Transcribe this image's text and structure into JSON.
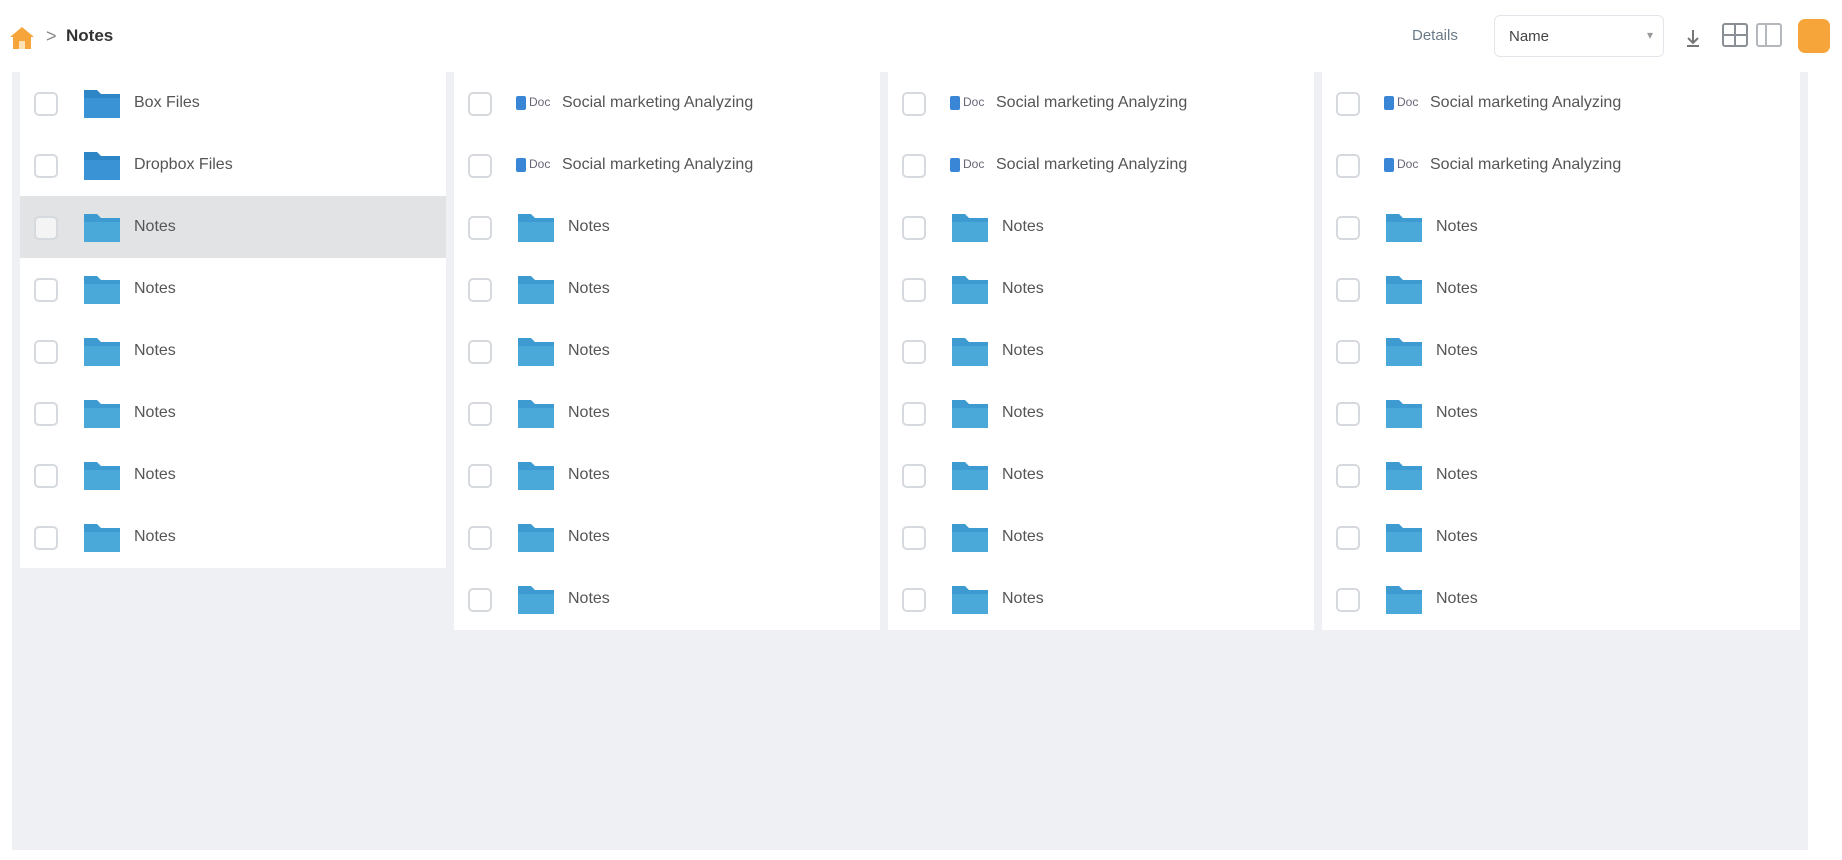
{
  "breadcrumb": {
    "separator": ">",
    "current": "Notes"
  },
  "toolbar": {
    "details_label": "Details",
    "sort_label": "Name",
    "sort_icon": "sort-arrow-icon",
    "view_icons": [
      "grid-view-icon",
      "columns-view-icon"
    ],
    "user_icon": "user-icon"
  },
  "colors": {
    "accent": "#f5a53a",
    "folder": "#4aa9d8",
    "folder_dark": "#2f86c7",
    "selected_row": "#e2e3e5"
  },
  "columns": [
    {
      "rows": [
        {
          "type": "folder",
          "name": "Box Files",
          "variant": "dark"
        },
        {
          "type": "folder",
          "name": "Dropbox Files",
          "variant": "dark"
        },
        {
          "type": "folder",
          "name": "Notes",
          "selected": true
        },
        {
          "type": "folder",
          "name": "Notes"
        },
        {
          "type": "folder",
          "name": "Notes"
        },
        {
          "type": "folder",
          "name": "Notes"
        },
        {
          "type": "folder",
          "name": "Notes"
        },
        {
          "type": "folder",
          "name": "Notes"
        }
      ]
    },
    {
      "rows": [
        {
          "type": "file",
          "thumb": "Doc",
          "name": "Social marketing Analyzing"
        },
        {
          "type": "file",
          "thumb": "Doc",
          "name": "Social marketing Analyzing"
        },
        {
          "type": "folder",
          "name": "Notes"
        },
        {
          "type": "folder",
          "name": "Notes"
        },
        {
          "type": "folder",
          "name": "Notes"
        },
        {
          "type": "folder",
          "name": "Notes"
        },
        {
          "type": "folder",
          "name": "Notes"
        },
        {
          "type": "folder",
          "name": "Notes"
        },
        {
          "type": "folder",
          "name": "Notes"
        }
      ]
    },
    {
      "rows": [
        {
          "type": "file",
          "thumb": "Doc",
          "name": "Social marketing Analyzing"
        },
        {
          "type": "file",
          "thumb": "Doc",
          "name": "Social marketing Analyzing"
        },
        {
          "type": "folder",
          "name": "Notes"
        },
        {
          "type": "folder",
          "name": "Notes"
        },
        {
          "type": "folder",
          "name": "Notes"
        },
        {
          "type": "folder",
          "name": "Notes"
        },
        {
          "type": "folder",
          "name": "Notes"
        },
        {
          "type": "folder",
          "name": "Notes"
        },
        {
          "type": "folder",
          "name": "Notes"
        }
      ]
    },
    {
      "rows": [
        {
          "type": "file",
          "thumb": "Doc",
          "name": "Social marketing Analyzing"
        },
        {
          "type": "file",
          "thumb": "Doc",
          "name": "Social marketing Analyzing"
        },
        {
          "type": "folder",
          "name": "Notes"
        },
        {
          "type": "folder",
          "name": "Notes"
        },
        {
          "type": "folder",
          "name": "Notes"
        },
        {
          "type": "folder",
          "name": "Notes"
        },
        {
          "type": "folder",
          "name": "Notes"
        },
        {
          "type": "folder",
          "name": "Notes"
        },
        {
          "type": "folder",
          "name": "Notes"
        }
      ]
    }
  ]
}
